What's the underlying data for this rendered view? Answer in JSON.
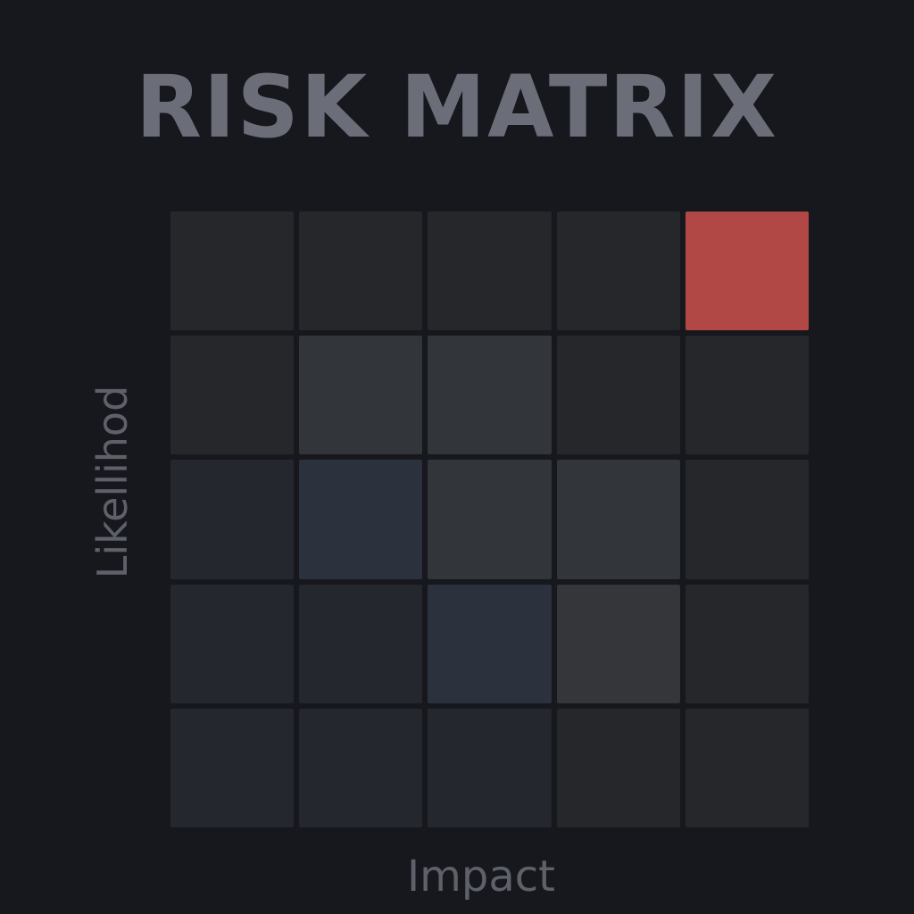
{
  "chart_data": {
    "type": "heatmap",
    "title": "RISK MATRIX",
    "xlabel": "Impact",
    "ylabel": "Likellihod",
    "rows": 5,
    "cols": 5,
    "cells": [
      [
        "#25272b",
        "#25272b",
        "#25272b",
        "#25272b",
        "#b24845"
      ],
      [
        "#25272b",
        "#323539",
        "#323539",
        "#25272b",
        "#25272b"
      ],
      [
        "#24272e",
        "#2b323d",
        "#323539",
        "#323539",
        "#25272b"
      ],
      [
        "#24272e",
        "#24272e",
        "#2b323d",
        "#343639",
        "#25272b"
      ],
      [
        "#24272e",
        "#24272e",
        "#24272e",
        "#25272b",
        "#25272b"
      ]
    ],
    "highlight": {
      "row": 0,
      "col": 4,
      "color": "#b24845"
    },
    "legend": "none",
    "grid": false
  }
}
